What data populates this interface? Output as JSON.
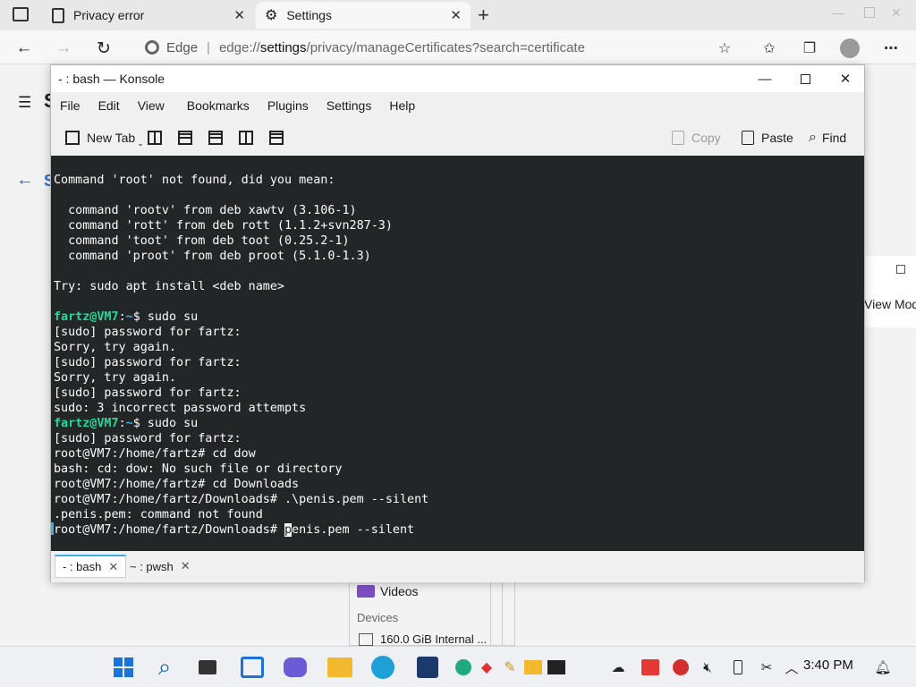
{
  "browser": {
    "tabs": [
      {
        "title": "Privacy error",
        "icon": "document-icon"
      },
      {
        "title": "Settings",
        "icon": "gear-icon"
      }
    ],
    "brand": "Edge",
    "url_prefix": "edge://",
    "url_bold": "settings",
    "url_rest": "/privacy/manageCertificates?search=certificate"
  },
  "background": {
    "view_mode_label": "View Mod",
    "videos_label": "Videos",
    "devices_heading": "Devices",
    "drive_label": "160.0 GiB Internal ..."
  },
  "konsole": {
    "title": "- : bash — Konsole",
    "menu": [
      "File",
      "Edit",
      "View",
      "Bookmarks",
      "Plugins",
      "Settings",
      "Help"
    ],
    "toolbar": {
      "new_tab": "New Tab",
      "copy": "Copy",
      "paste": "Paste",
      "find": "Find"
    },
    "tabs": [
      {
        "label": "- : bash",
        "active": true
      },
      {
        "label": "~ : pwsh",
        "active": false
      }
    ],
    "terminal": {
      "lines": [
        "Command 'root' not found, did you mean:",
        "",
        "  command 'rootv' from deb xawtv (3.106-1)",
        "  command 'rott' from deb rott (1.1.2+svn287-3)",
        "  command 'toot' from deb toot (0.25.2-1)",
        "  command 'proot' from deb proot (5.1.0-1.3)",
        "",
        "Try: sudo apt install <deb name>",
        ""
      ],
      "prompt_user": "fartz@VM7",
      "prompt_path": "~",
      "session": [
        {
          "type": "prompt",
          "cmd": " sudo su"
        },
        {
          "type": "text",
          "text": "[sudo] password for fartz:"
        },
        {
          "type": "text",
          "text": "Sorry, try again."
        },
        {
          "type": "text",
          "text": "[sudo] password for fartz:"
        },
        {
          "type": "text",
          "text": "Sorry, try again."
        },
        {
          "type": "text",
          "text": "[sudo] password for fartz:"
        },
        {
          "type": "text",
          "text": "sudo: 3 incorrect password attempts"
        },
        {
          "type": "prompt",
          "cmd": " sudo su"
        },
        {
          "type": "text",
          "text": "[sudo] password for fartz:"
        },
        {
          "type": "text",
          "text": "root@VM7:/home/fartz# cd dow"
        },
        {
          "type": "text",
          "text": "bash: cd: dow: No such file or directory"
        },
        {
          "type": "text",
          "text": "root@VM7:/home/fartz# cd Downloads"
        },
        {
          "type": "text",
          "text": "root@VM7:/home/fartz/Downloads# .\\penis.pem --silent"
        },
        {
          "type": "text",
          "text": ".penis.pem: command not found"
        }
      ],
      "last_prompt": "root@VM7:/home/fartz/Downloads# ",
      "last_cursor_char": "p",
      "last_rest": "enis.pem --silent"
    }
  },
  "taskbar": {
    "apps": [
      "start-icon",
      "search-icon",
      "task-view-icon",
      "widgets-icon",
      "chat-icon",
      "file-explorer-icon",
      "edge-icon",
      "visual-studio-icon",
      "edge-dev-icon",
      "git-icon",
      "paint-icon",
      "folder-icon",
      "terminal-icon"
    ],
    "clock": "3:40 PM"
  }
}
